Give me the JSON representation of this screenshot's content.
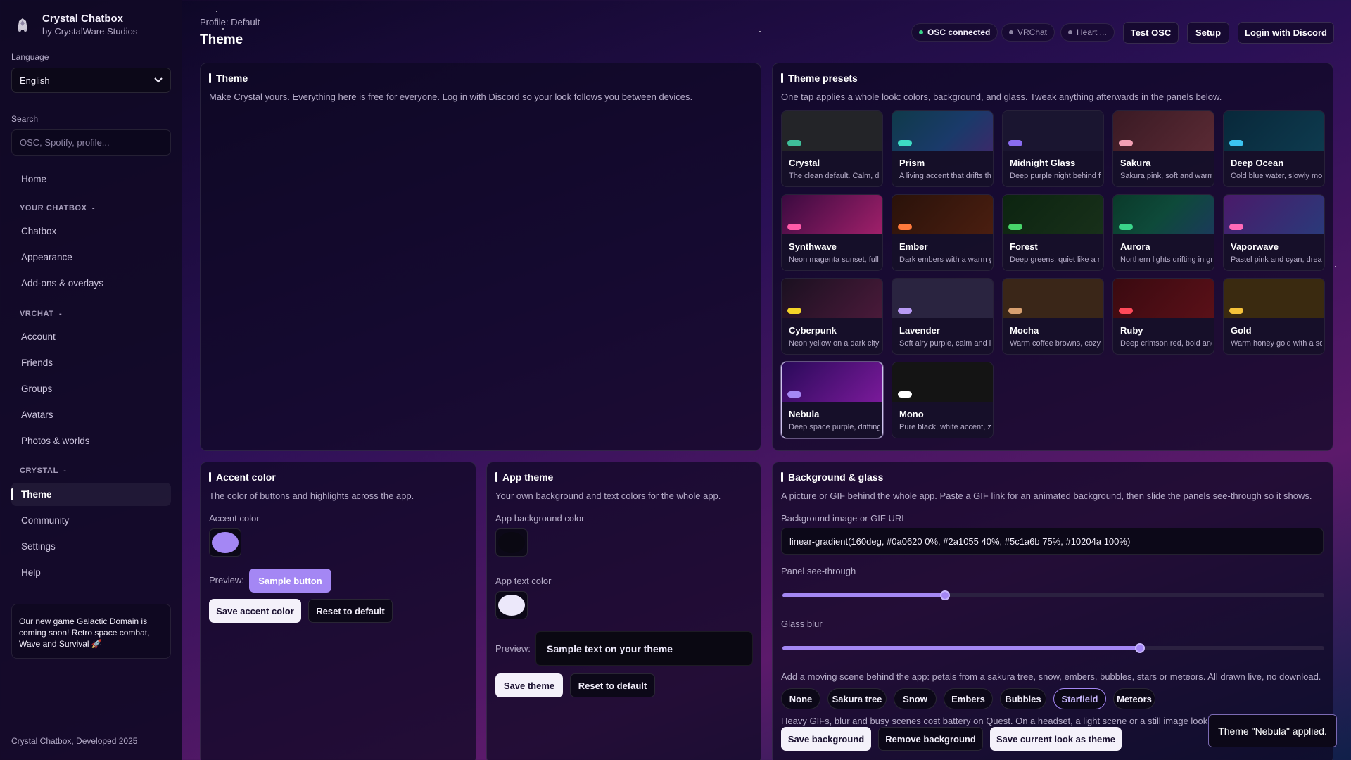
{
  "sidebar": {
    "app_title": "Crystal Chatbox",
    "app_subtitle": "by CrystalWare Studios",
    "language_label": "Language",
    "language_value": "English",
    "search_label": "Search",
    "search_placeholder": "OSC, Spotify, profile...",
    "home": "Home",
    "sections": {
      "chatbox": "YOUR CHATBOX",
      "vrchat": "VRCHAT",
      "crystal": "CRYSTAL"
    },
    "collapse_glyph": "-",
    "items": {
      "chatbox": "Chatbox",
      "appearance": "Appearance",
      "addons": "Add-ons & overlays",
      "account": "Account",
      "friends": "Friends",
      "groups": "Groups",
      "avatars": "Avatars",
      "photos": "Photos & worlds",
      "theme": "Theme",
      "community": "Community",
      "settings": "Settings",
      "help": "Help"
    },
    "promo": "Our new game Galactic Domain is coming soon! Retro space combat, Wave and Survival 🚀",
    "footer": "Crystal Chatbox, Developed 2025"
  },
  "header": {
    "profile": "Profile: Default",
    "title": "Theme",
    "status": {
      "osc": "OSC connected",
      "vrchat": "VRChat",
      "heart": "Heart ..."
    },
    "buttons": {
      "test_osc": "Test OSC",
      "setup": "Setup",
      "login": "Login with Discord"
    }
  },
  "theme_panel": {
    "title": "Theme",
    "desc": "Make Crystal yours. Everything here is free for everyone. Log in with Discord so your look follows you between devices."
  },
  "presets_panel": {
    "title": "Theme presets",
    "desc": "One tap applies a whole look: colors, background, and glass. Tweak anything afterwards in the panels below.",
    "presets": [
      {
        "name": "Crystal",
        "desc": "The clean default. Calm, dark",
        "accent": "#3fbf9a",
        "bg": "#232428"
      },
      {
        "name": "Prism",
        "desc": "A living accent that drifts through",
        "accent": "#3ddbc4",
        "bg": "linear-gradient(135deg,#0f3a4a,#1a3a6a 60%,#3a2a6a)"
      },
      {
        "name": "Midnight Glass",
        "desc": "Deep purple night behind frosted",
        "accent": "#8a6cf0",
        "bg": "#1a1530"
      },
      {
        "name": "Sakura",
        "desc": "Sakura pink, soft and warm",
        "accent": "#f2a0b4",
        "bg": "linear-gradient(135deg,#3a1a24,#5a2a34)"
      },
      {
        "name": "Deep Ocean",
        "desc": "Cold blue water, slowly moving",
        "accent": "#3cc4f0",
        "bg": "linear-gradient(135deg,#08283a,#0e3a4e)"
      },
      {
        "name": "Synthwave",
        "desc": "Neon magenta sunset, full retro",
        "accent": "#ff5aa8",
        "bg": "linear-gradient(135deg,#3a0a40,#a0206a)"
      },
      {
        "name": "Ember",
        "desc": "Dark embers with a warm glow",
        "accent": "#ff7a3c",
        "bg": "linear-gradient(135deg,#2a120a,#4a1e10)"
      },
      {
        "name": "Forest",
        "desc": "Deep greens, quiet like a night",
        "accent": "#48d46a",
        "bg": "linear-gradient(135deg,#0c2410,#18301a)"
      },
      {
        "name": "Aurora",
        "desc": "Northern lights drifting in green",
        "accent": "#3ad48a",
        "bg": "linear-gradient(135deg,#0a3a2a,#0e4a3a 50%,#1a3a5a)"
      },
      {
        "name": "Vaporwave",
        "desc": "Pastel pink and cyan, dreamy",
        "accent": "#ff6ab8",
        "bg": "linear-gradient(135deg,#4a1a6a,#2a3a7a)"
      },
      {
        "name": "Cyberpunk",
        "desc": "Neon yellow on a dark city",
        "accent": "#f5d428",
        "bg": "linear-gradient(135deg,#1a1020,#4a1a3a)"
      },
      {
        "name": "Lavender",
        "desc": "Soft airy purple, calm and light",
        "accent": "#b89af5",
        "bg": "#2a2440"
      },
      {
        "name": "Mocha",
        "desc": "Warm coffee browns, cozy",
        "accent": "#d8a070",
        "bg": "#3a2618"
      },
      {
        "name": "Ruby",
        "desc": "Deep crimson red, bold and",
        "accent": "#ff4a5a",
        "bg": "linear-gradient(135deg,#3a0a10,#5a1018)"
      },
      {
        "name": "Gold",
        "desc": "Warm honey gold with a soft",
        "accent": "#f5c23a",
        "bg": "#3a2a10"
      },
      {
        "name": "Nebula",
        "desc": "Deep space purple, drifting",
        "accent": "#a487f4",
        "bg": "linear-gradient(135deg,#2a0a5a,#7a1a9a)"
      },
      {
        "name": "Mono",
        "desc": "Pure black, white accent, zero",
        "accent": "#ffffff",
        "bg": "#141414"
      }
    ]
  },
  "accent_panel": {
    "title": "Accent color",
    "desc": "The color of buttons and highlights across the app.",
    "field_label": "Accent color",
    "accent_value": "#a487f4",
    "preview_label": "Preview:",
    "sample_button": "Sample button",
    "save": "Save accent color",
    "reset": "Reset to default"
  },
  "app_theme_panel": {
    "title": "App theme",
    "desc": "Your own background and text colors for the whole app.",
    "bg_label": "App background color",
    "bg_value": "#0a0812",
    "text_label": "App text color",
    "text_value": "#ece8fa",
    "preview_label": "Preview:",
    "preview_text": "Sample text on your theme",
    "save": "Save theme",
    "reset": "Reset to default"
  },
  "bg_panel": {
    "title": "Background & glass",
    "desc": "A picture or GIF behind the whole app. Paste a GIF link for an animated background, then slide the panels see-through so it shows.",
    "url_label": "Background image or GIF URL",
    "url_value": "linear-gradient(160deg, #0a0620 0%, #2a1055 40%, #5c1a6b 75%, #10204a 100%)",
    "see_through_label": "Panel see-through",
    "see_through_value": 0.3,
    "blur_label": "Glass blur",
    "blur_value": 0.66,
    "scene_desc": "Add a moving scene behind the app: petals from a sakura tree, snow, embers, bubbles, stars or meteors. All drawn live, no download.",
    "scenes": [
      "None",
      "Sakura tree",
      "Snow",
      "Embers",
      "Bubbles",
      "Starfield",
      "Meteors"
    ],
    "selected_scene": "Starfield",
    "note": "Heavy GIFs, blur and busy scenes cost battery on Quest. On a headset, a light scene or a still image looks just as good.",
    "save": "Save background",
    "remove": "Remove background",
    "save_look": "Save current look as theme"
  },
  "toast": "Theme \"Nebula\" applied.",
  "colors": {
    "accent": "#a487f4",
    "status_green": "#3ad48a"
  },
  "icons": {
    "brand": "crystal-logo-icon",
    "select_caret": "chevron-down-icon",
    "rocket": "rocket-emoji"
  }
}
